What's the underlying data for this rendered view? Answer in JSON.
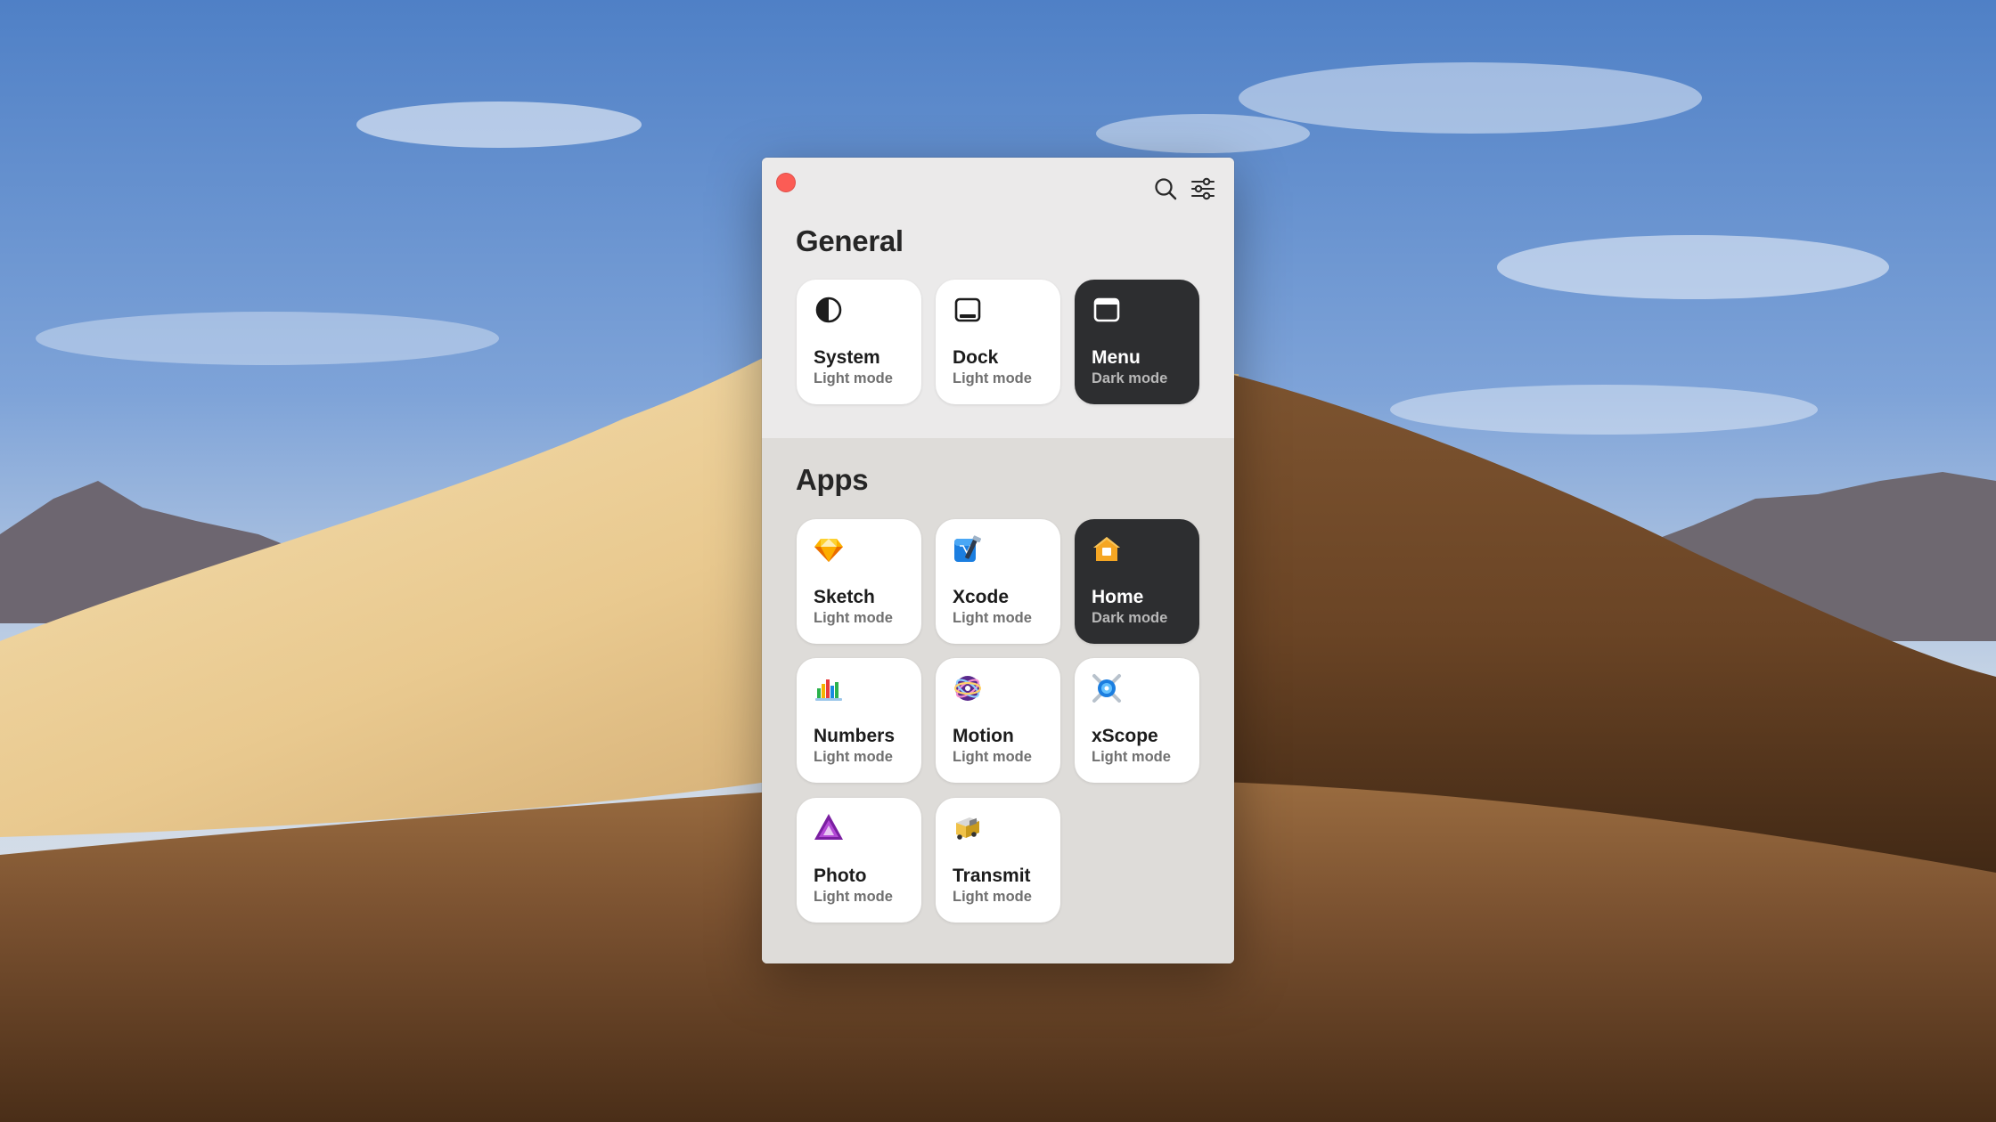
{
  "window": {
    "general": {
      "title": "General",
      "tiles": [
        {
          "name": "System",
          "mode": "Light mode",
          "icon": "half-circle-icon",
          "dark": false
        },
        {
          "name": "Dock",
          "mode": "Light mode",
          "icon": "dock-icon",
          "dark": false
        },
        {
          "name": "Menu",
          "mode": "Dark mode",
          "icon": "menu-bar-icon",
          "dark": true
        }
      ]
    },
    "apps": {
      "title": "Apps",
      "tiles": [
        {
          "name": "Sketch",
          "mode": "Light mode",
          "icon": "sketch-app-icon",
          "dark": false
        },
        {
          "name": "Xcode",
          "mode": "Light mode",
          "icon": "xcode-app-icon",
          "dark": false
        },
        {
          "name": "Home",
          "mode": "Dark mode",
          "icon": "home-app-icon",
          "dark": true
        },
        {
          "name": "Numbers",
          "mode": "Light mode",
          "icon": "numbers-app-icon",
          "dark": false
        },
        {
          "name": "Motion",
          "mode": "Light mode",
          "icon": "motion-app-icon",
          "dark": false
        },
        {
          "name": "xScope",
          "mode": "Light mode",
          "icon": "xscope-app-icon",
          "dark": false
        },
        {
          "name": "Photo",
          "mode": "Light mode",
          "icon": "affinity-photo-app-icon",
          "dark": false
        },
        {
          "name": "Transmit",
          "mode": "Light mode",
          "icon": "transmit-app-icon",
          "dark": false
        }
      ]
    }
  },
  "colors": {
    "close_button": "#fc5c55",
    "dark_tile": "#2d2e30",
    "light_tile": "#ffffff"
  }
}
